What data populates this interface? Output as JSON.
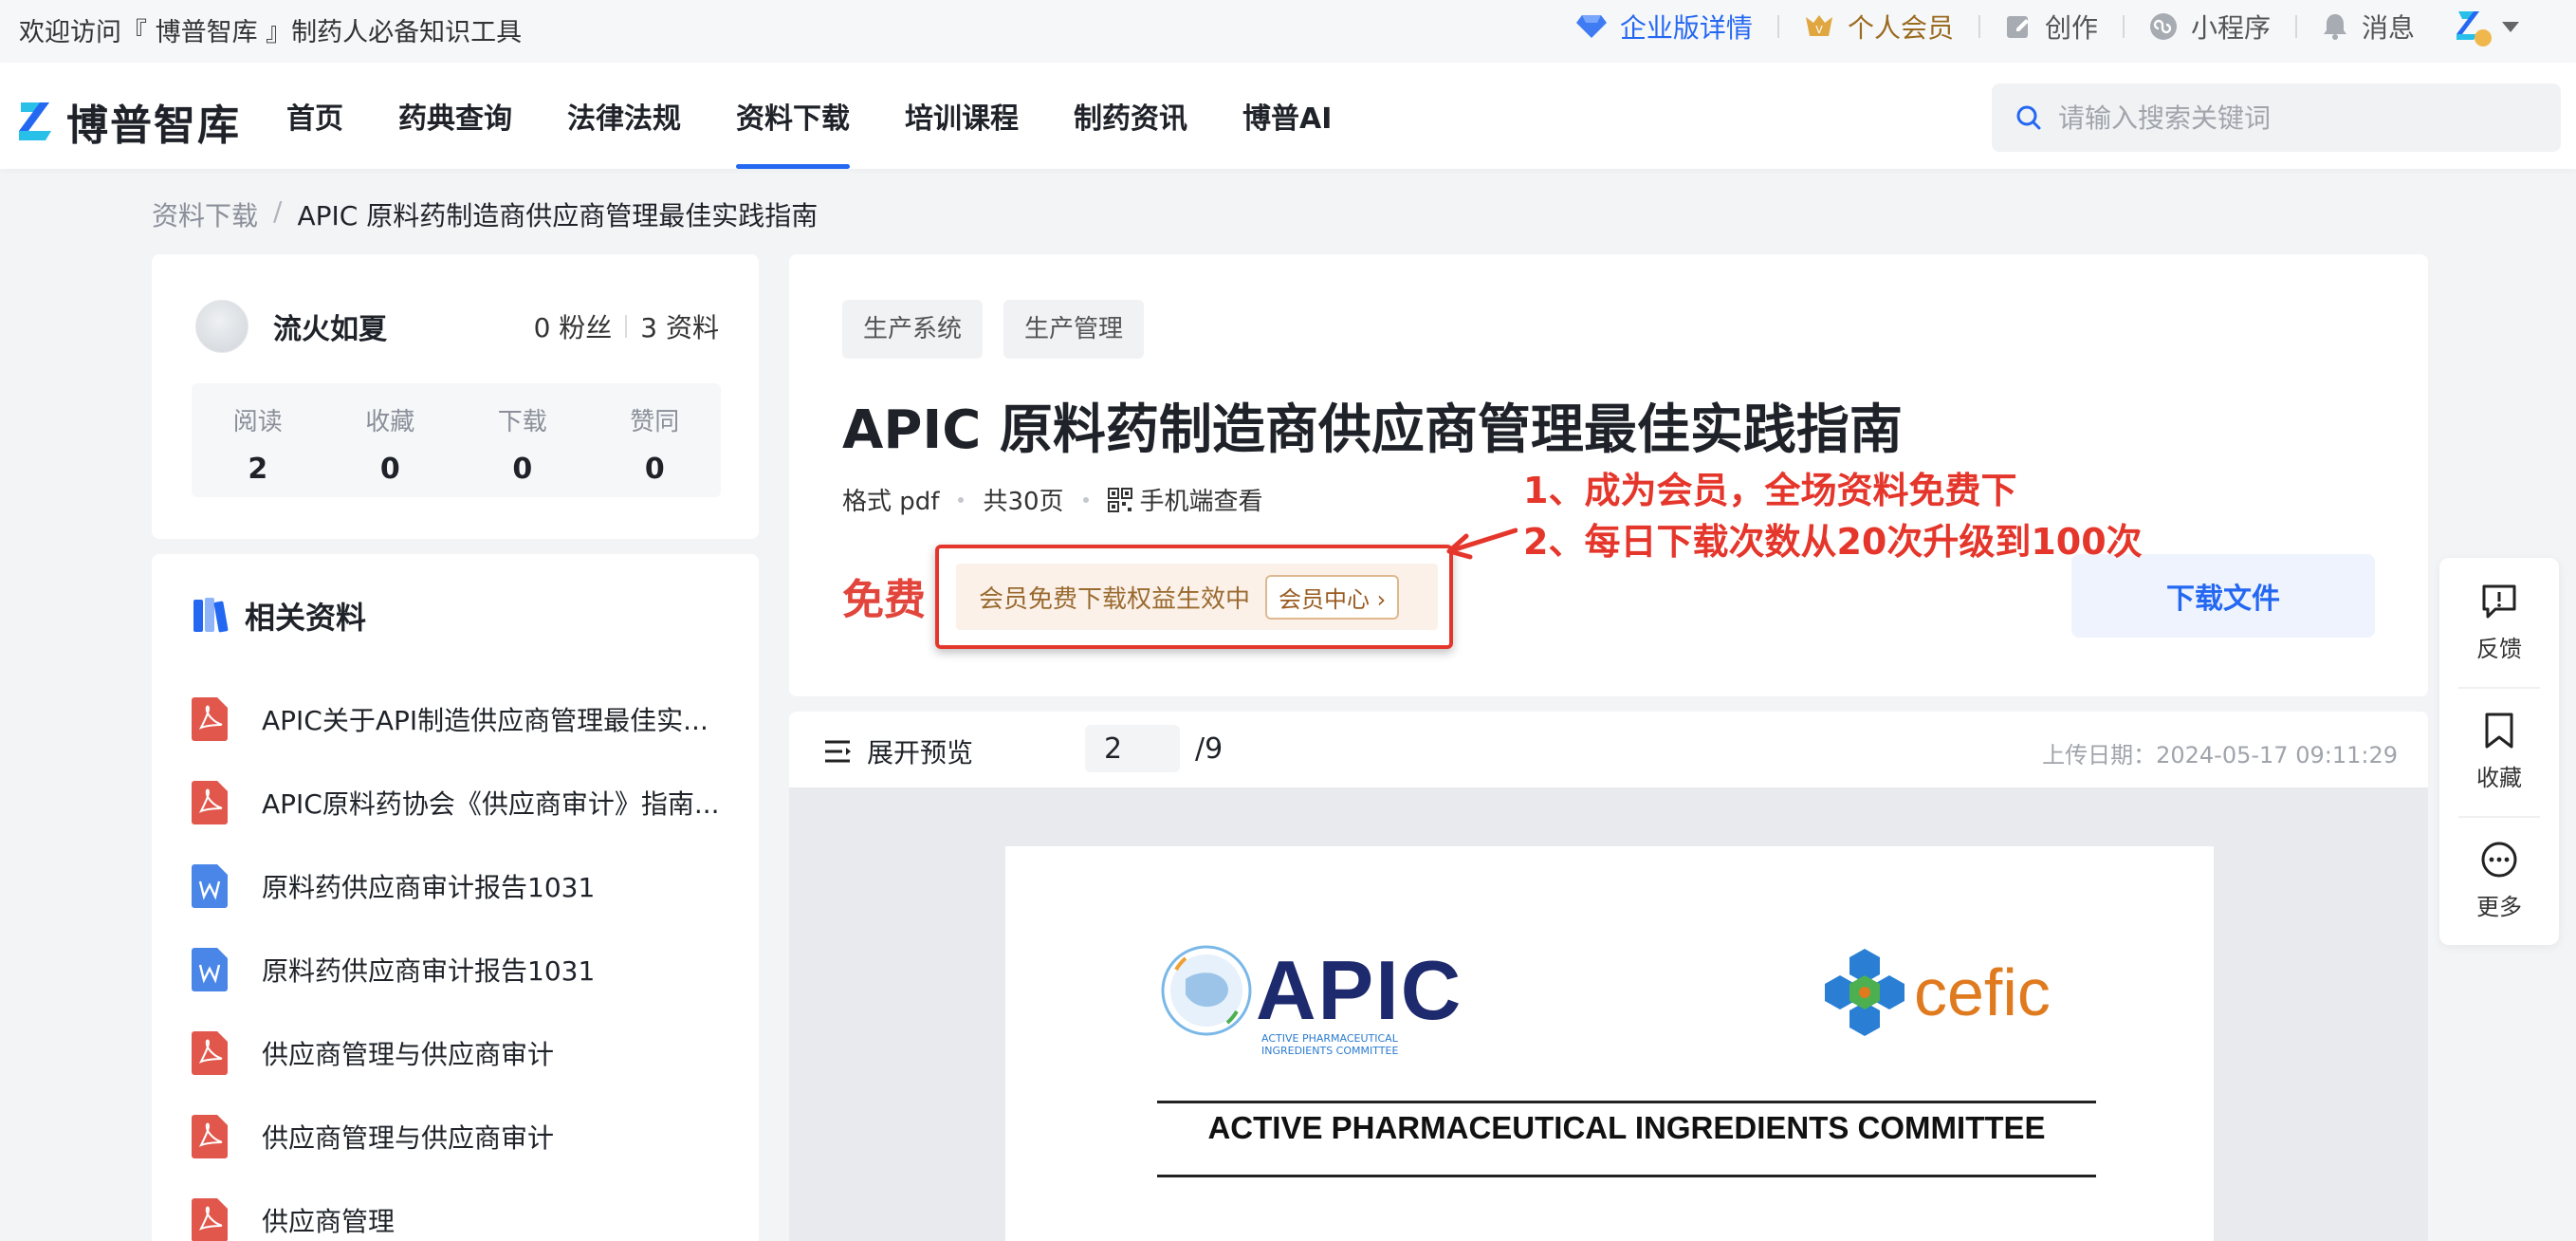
{
  "topbar": {
    "welcome": "欢迎访问『 博普智库 』制药人必备知识工具",
    "links": {
      "enterprise": "企业版详情",
      "member": "个人会员",
      "create": "创作",
      "miniapp": "小程序",
      "messages": "消息"
    }
  },
  "nav": {
    "logo": "博普智库",
    "menu": [
      "首页",
      "药典查询",
      "法律法规",
      "资料下载",
      "培训课程",
      "制药资讯",
      "博普AI"
    ],
    "active_index": 3,
    "search_placeholder": "请输入搜索关键词"
  },
  "breadcrumb": {
    "parent": "资料下载",
    "separator": "/",
    "current": "APIC 原料药制造商供应商管理最佳实践指南"
  },
  "author": {
    "name": "流火如夏",
    "fans": "0 粉丝",
    "docs": "3 资料",
    "stats": [
      {
        "label": "阅读",
        "value": "2"
      },
      {
        "label": "收藏",
        "value": "0"
      },
      {
        "label": "下载",
        "value": "0"
      },
      {
        "label": "赞同",
        "value": "0"
      }
    ]
  },
  "related": {
    "title": "相关资料",
    "items": [
      {
        "text": "APIC关于API制造供应商管理最佳实...",
        "type": "pdf"
      },
      {
        "text": "APIC原料药协会《供应商审计》指南...",
        "type": "pdf"
      },
      {
        "text": "原料药供应商审计报告1031",
        "type": "word"
      },
      {
        "text": "原料药供应商审计报告1031",
        "type": "word"
      },
      {
        "text": "供应商管理与供应商审计",
        "type": "pdf"
      },
      {
        "text": "供应商管理与供应商审计",
        "type": "pdf"
      },
      {
        "text": "供应商管理",
        "type": "pdf"
      }
    ]
  },
  "document": {
    "tags": [
      "生产系统",
      "生产管理"
    ],
    "title": "APIC 原料药制造商供应商管理最佳实践指南",
    "format": "格式 pdf",
    "pages": "共30页",
    "mobile": "手机端查看",
    "price": "免费",
    "vip_text": "会员免费下载权益生效中",
    "vip_button": "会员中心 ›",
    "download": "下载文件"
  },
  "annotation": {
    "line1": "1、成为会员，全场资料免费下",
    "line2": "2、每日下载次数从20次升级到100次"
  },
  "preview": {
    "expand": "展开预览",
    "page_value": "2",
    "page_total": "/9",
    "upload_date": "上传日期：2024-05-17 09:11:29",
    "apic": "APIC",
    "apic_sub1": "ACTIVE PHARMACEUTICAL",
    "apic_sub2": "INGREDIENTS COMMITTEE",
    "cefic": "cefic",
    "committee": "ACTIVE PHARMACEUTICAL INGREDIENTS COMMITTEE"
  },
  "floatbar": {
    "feedback": "反馈",
    "favorite": "收藏",
    "more": "更多"
  },
  "colors": {
    "brand": "#2468f2",
    "price_red": "#e2453c",
    "annotation_red": "#e5362c"
  }
}
